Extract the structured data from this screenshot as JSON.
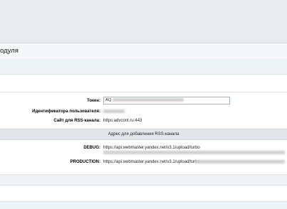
{
  "header": {
    "title": "одуля"
  },
  "form": {
    "token_label": "Токен:",
    "token_value": "AQ",
    "user_id_label": "Идентификатора пользователя:",
    "rss_label": "Сайт для RSS-канала:",
    "rss_value": "https:advcont.ru:443"
  },
  "section": {
    "title": "Адрес для добавления RSS-канала"
  },
  "endpoints": {
    "debug_label": "DEBUG:",
    "debug_url": "https://api.webmaster.yandex.net/v3.1/upload/turbo",
    "production_label": "PRODUCTION:",
    "production_url": "https://api.webmaster.yandex.net/v3.1/upload/turbo"
  }
}
